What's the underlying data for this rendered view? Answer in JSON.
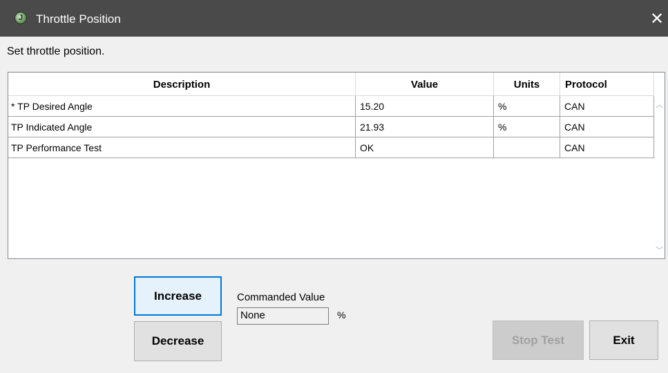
{
  "window": {
    "title": "Throttle Position",
    "icon": "app-logo-icon",
    "close_glyph": "✕"
  },
  "instruction": "Set throttle position.",
  "table": {
    "columns": [
      "Description",
      "Value",
      "Units",
      "Protocol"
    ],
    "rows": [
      {
        "description": "* TP Desired Angle",
        "value": "15.20",
        "units": "%",
        "protocol": "CAN"
      },
      {
        "description": "TP Indicated Angle",
        "value": "21.93",
        "units": "%",
        "protocol": "CAN"
      },
      {
        "description": "TP Performance Test",
        "value": "OK",
        "units": "",
        "protocol": "CAN"
      }
    ]
  },
  "controls": {
    "increase_label": "Increase",
    "decrease_label": "Decrease",
    "commanded_label": "Commanded Value",
    "commanded_value": "None",
    "commanded_unit": "%",
    "stop_label": "Stop Test",
    "exit_label": "Exit"
  },
  "colors": {
    "titlebar": "#4a4a4a",
    "focus_border": "#0078d7",
    "disabled_text": "#a0a0a0"
  }
}
